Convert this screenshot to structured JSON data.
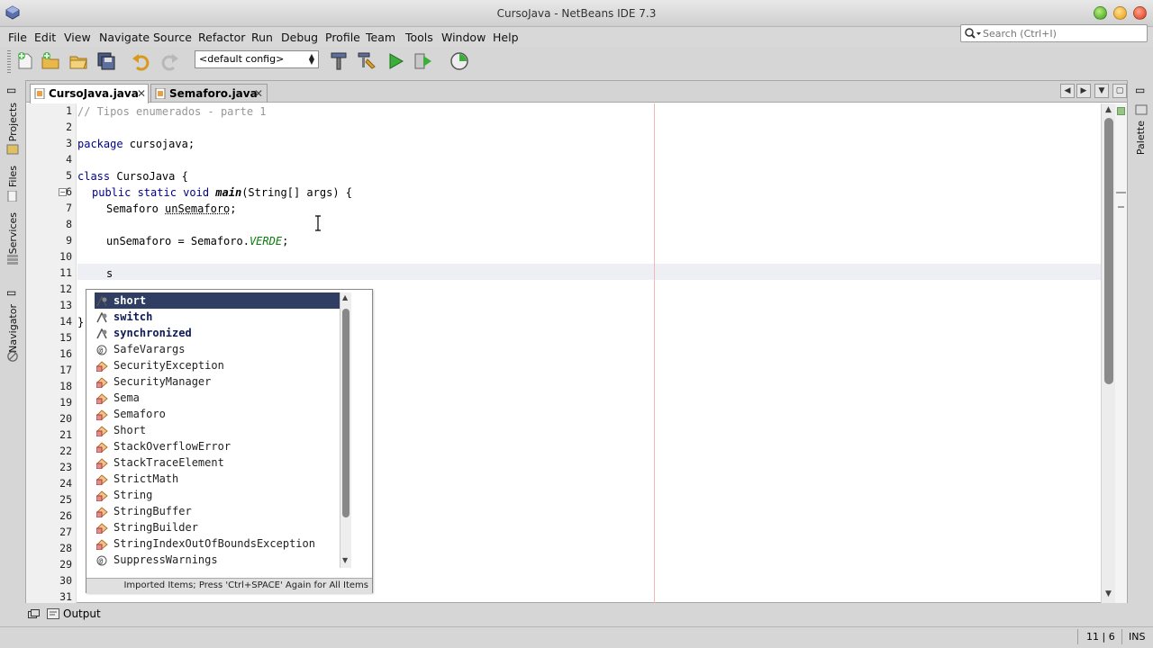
{
  "window": {
    "title": "CursoJava - NetBeans IDE 7.3"
  },
  "menu": [
    "File",
    "Edit",
    "View",
    "Navigate",
    "Source",
    "Refactor",
    "Run",
    "Debug",
    "Profile",
    "Team",
    "Tools",
    "Window",
    "Help"
  ],
  "search": {
    "placeholder": "Search (Ctrl+I)"
  },
  "toolbar": {
    "config": "<default config>"
  },
  "tabs": [
    {
      "label": "CursoJava.java",
      "active": true
    },
    {
      "label": "Semaforo.java",
      "active": false
    }
  ],
  "side_left": [
    "Projects",
    "Files",
    "Services",
    "Navigator"
  ],
  "side_right": [
    "Palette"
  ],
  "line_numbers": [
    "1",
    "2",
    "3",
    "4",
    "5",
    "6",
    "7",
    "8",
    "9",
    "10",
    "11",
    "12",
    "13",
    "14",
    "15",
    "16",
    "17",
    "18",
    "19",
    "20",
    "21",
    "22",
    "23",
    "24",
    "25",
    "26",
    "27",
    "28",
    "29",
    "30",
    "31"
  ],
  "code": {
    "l1": "// Tipos enumerados - parte 1",
    "l3_kw": "package",
    "l3_rest": " cursojava;",
    "l5_kw": "class",
    "l5_rest": " CursoJava {",
    "l6_kw": "public static void",
    "l6_method": "main",
    "l6_rest": "(String[] args) {",
    "l7_type": "Semaforo",
    "l7_var": "unSemaforo",
    "l7_end": ";",
    "l9_a": "unSemaforo = Semaforo.",
    "l9_field": "VERDE",
    "l9_end": ";",
    "l11": "s",
    "l14": "}"
  },
  "completion": {
    "items": [
      {
        "label": "short",
        "kind": "keyword",
        "selected": true
      },
      {
        "label": "switch",
        "kind": "keyword"
      },
      {
        "label": "synchronized",
        "kind": "keyword"
      },
      {
        "label": "SafeVarargs",
        "kind": "annotation"
      },
      {
        "label": "SecurityException",
        "kind": "class"
      },
      {
        "label": "SecurityManager",
        "kind": "class"
      },
      {
        "label": "Sema",
        "kind": "class"
      },
      {
        "label": "Semaforo",
        "kind": "class"
      },
      {
        "label": "Short",
        "kind": "class"
      },
      {
        "label": "StackOverflowError",
        "kind": "class"
      },
      {
        "label": "StackTraceElement",
        "kind": "class"
      },
      {
        "label": "StrictMath",
        "kind": "class"
      },
      {
        "label": "String",
        "kind": "class"
      },
      {
        "label": "StringBuffer",
        "kind": "class"
      },
      {
        "label": "StringBuilder",
        "kind": "class"
      },
      {
        "label": "StringIndexOutOfBoundsException",
        "kind": "class"
      },
      {
        "label": "SuppressWarnings",
        "kind": "annotation"
      }
    ],
    "footer": "Imported Items; Press 'Ctrl+SPACE' Again for All Items"
  },
  "output": {
    "label": "Output"
  },
  "status": {
    "position": "11 | 6",
    "mode": "INS"
  },
  "colors": {
    "selection": "#2f3e62",
    "keyword": "#00008a",
    "comment": "#969696",
    "field": "#0b7c0b"
  }
}
